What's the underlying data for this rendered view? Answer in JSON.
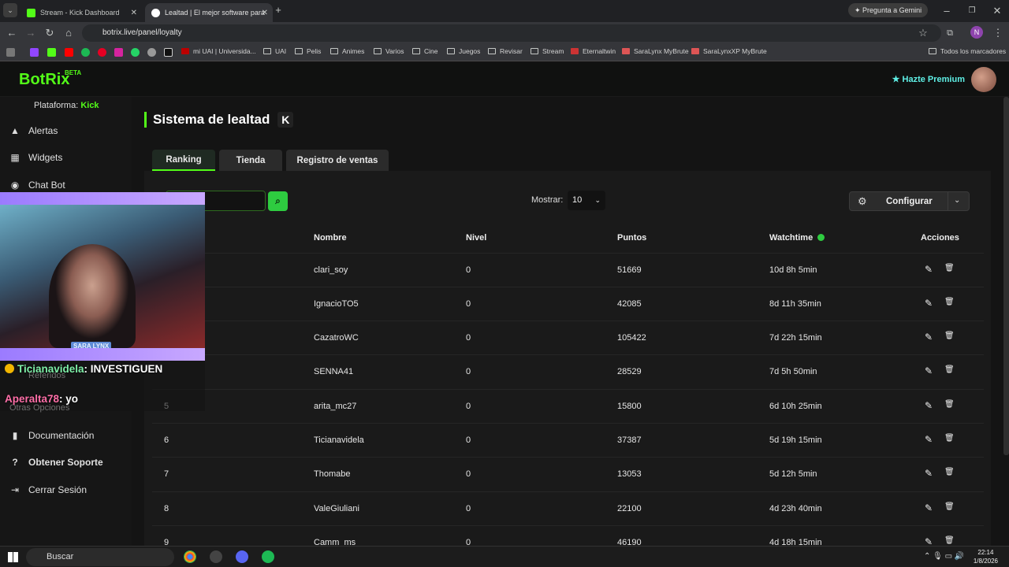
{
  "browser": {
    "tabs": [
      {
        "title": "Stream - Kick Dashboard",
        "active": false
      },
      {
        "title": "Lealtad | El mejor software para",
        "active": true
      }
    ],
    "gemini_label": "Pregunta a Gemini",
    "url": "botrix.live/panel/loyalty",
    "bookmarks": [
      "mi UAI | Universida...",
      "UAI",
      "Pelis",
      "Animes",
      "Varios",
      "Cine",
      "Juegos",
      "Revisar",
      "Stream",
      "Eternaltwin",
      "SaraLynx MyBrute",
      "SaraLynxXP MyBrute"
    ],
    "all_bookmarks": "Todos los marcadores",
    "profile_initial": "N"
  },
  "app": {
    "logo": "BotRix",
    "logo_badge": "BETA",
    "premium_label": "Hazte Premium",
    "platform_label": "Plataforma:",
    "platform_value": "Kick",
    "accent": "#53fc18",
    "sidebar": {
      "items": [
        {
          "label": "Alertas",
          "icon": "warning-icon"
        },
        {
          "label": "Widgets",
          "icon": "grid-icon"
        },
        {
          "label": "Chat Bot",
          "icon": "robot-icon"
        },
        {
          "label": "Referidos",
          "icon": "users-icon"
        },
        {
          "label": "Otras Opciones",
          "icon": "dots-icon"
        },
        {
          "label": "Documentación",
          "icon": "book-icon"
        },
        {
          "label": "Obtener Soporte",
          "icon": "help-icon"
        },
        {
          "label": "Cerrar Sesión",
          "icon": "logout-icon"
        }
      ]
    },
    "page_title": "Sistema de lealtad",
    "page_badge": "K",
    "tabs": [
      "Ranking",
      "Tienda",
      "Registro de ventas"
    ],
    "active_tab": "Ranking",
    "mostrar_label": "Mostrar:",
    "mostrar_value": "10",
    "configure_label": "Configurar",
    "table": {
      "headers": [
        "Nombre",
        "Nivel",
        "Puntos",
        "Watchtime",
        "Acciones"
      ],
      "rows": [
        {
          "rank": "",
          "name": "clari_soy",
          "level": "0",
          "points": "51669",
          "watchtime": "10d 8h 5min"
        },
        {
          "rank": "",
          "name": "IgnacioTO5",
          "level": "0",
          "points": "42085",
          "watchtime": "8d 11h 35min"
        },
        {
          "rank": "",
          "name": "CazatroWC",
          "level": "0",
          "points": "105422",
          "watchtime": "7d 22h 15min"
        },
        {
          "rank": "",
          "name": "SENNA41",
          "level": "0",
          "points": "28529",
          "watchtime": "7d 5h 50min"
        },
        {
          "rank": "5",
          "name": "arita_mc27",
          "level": "0",
          "points": "15800",
          "watchtime": "6d 10h 25min"
        },
        {
          "rank": "6",
          "name": "Ticianavidela",
          "level": "0",
          "points": "37387",
          "watchtime": "5d 19h 15min"
        },
        {
          "rank": "7",
          "name": "Thomabe",
          "level": "0",
          "points": "13053",
          "watchtime": "5d 12h 5min"
        },
        {
          "rank": "8",
          "name": "ValeGiuliani",
          "level": "0",
          "points": "22100",
          "watchtime": "4d 23h 40min"
        },
        {
          "rank": "9",
          "name": "Camm_ms",
          "level": "0",
          "points": "46190",
          "watchtime": "4d 18h 15min"
        }
      ]
    }
  },
  "overlay": {
    "cam_name": "SARA LYNX",
    "chat": [
      {
        "user": "Ticianavidela",
        "message": ": INVESTIGUEN"
      },
      {
        "user": "Aperalta78",
        "message": ": yo"
      }
    ]
  },
  "taskbar": {
    "search_label": "Buscar",
    "time": "22:14",
    "date": "1/8/2026"
  }
}
